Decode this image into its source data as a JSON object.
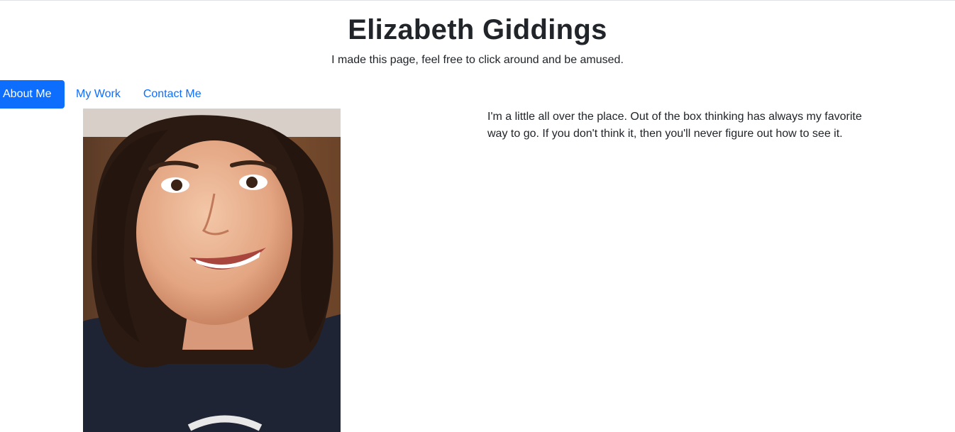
{
  "header": {
    "title": "Elizabeth Giddings",
    "subtitle": "I made this page, feel free to click around and be amused."
  },
  "nav": {
    "items": [
      {
        "label": "About Me",
        "active": true
      },
      {
        "label": "My Work",
        "active": false
      },
      {
        "label": "Contact Me",
        "active": false
      }
    ]
  },
  "about": {
    "photo_alt": "portrait-photo",
    "text": "I'm a little all over the place. Out of the box thinking has always my favorite way to go. If you don't think it, then you'll never figure out how to see it."
  },
  "colors": {
    "accent": "#0d6efd",
    "text": "#212529"
  }
}
